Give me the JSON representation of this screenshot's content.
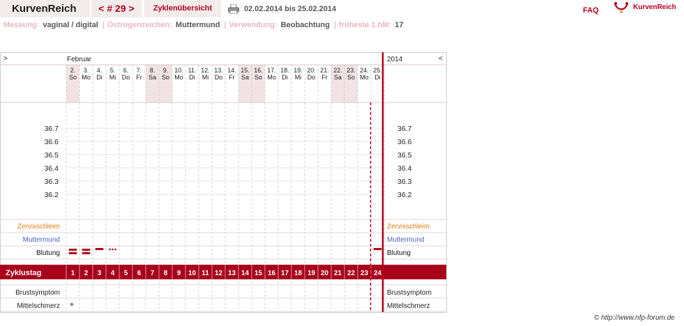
{
  "header": {
    "brand": "KurvenReich",
    "cycle_nav": "< # 29 >",
    "overview_tab": "Zyklenübersicht",
    "date_range": "02.02.2014 bis 25.02.2014",
    "faq": "FAQ",
    "logo_text": "KurvenReich",
    "print_icon": "printer-icon"
  },
  "info": {
    "measurement_label": "Messung:",
    "measurement_value": "vaginal / digital",
    "estrogen_label": "Östrogenzeichen:",
    "estrogen_value": "Muttermund",
    "usage_label": "Verwendung:",
    "usage_value": "Beobachtung",
    "earliest_label": "früheste 1.hM:",
    "earliest_value": "17"
  },
  "chart": {
    "expand_left": ">",
    "expand_right": "<",
    "month": "Februar",
    "year": "2014",
    "days": [
      {
        "date": "2.",
        "wd": "So",
        "cd": "1",
        "weekend": true
      },
      {
        "date": "3.",
        "wd": "Mo",
        "cd": "2",
        "weekend": false
      },
      {
        "date": "4.",
        "wd": "Di",
        "cd": "3",
        "weekend": false
      },
      {
        "date": "5.",
        "wd": "Mi",
        "cd": "4",
        "weekend": false
      },
      {
        "date": "6.",
        "wd": "Do",
        "cd": "5",
        "weekend": false
      },
      {
        "date": "7.",
        "wd": "Fr",
        "cd": "6",
        "weekend": false
      },
      {
        "date": "8.",
        "wd": "Sa",
        "cd": "7",
        "weekend": true
      },
      {
        "date": "9.",
        "wd": "So",
        "cd": "8",
        "weekend": true
      },
      {
        "date": "10.",
        "wd": "Mo",
        "cd": "9",
        "weekend": false
      },
      {
        "date": "11.",
        "wd": "Di",
        "cd": "10",
        "weekend": false
      },
      {
        "date": "12.",
        "wd": "Mi",
        "cd": "11",
        "weekend": false
      },
      {
        "date": "13.",
        "wd": "Do",
        "cd": "12",
        "weekend": false
      },
      {
        "date": "14.",
        "wd": "Fr",
        "cd": "13",
        "weekend": false
      },
      {
        "date": "15.",
        "wd": "Sa",
        "cd": "14",
        "weekend": true
      },
      {
        "date": "16.",
        "wd": "So",
        "cd": "15",
        "weekend": true
      },
      {
        "date": "17.",
        "wd": "Mo",
        "cd": "16",
        "weekend": false
      },
      {
        "date": "18.",
        "wd": "Di",
        "cd": "17",
        "weekend": false
      },
      {
        "date": "19.",
        "wd": "Mi",
        "cd": "18",
        "weekend": false
      },
      {
        "date": "20.",
        "wd": "Do",
        "cd": "19",
        "weekend": false
      },
      {
        "date": "21.",
        "wd": "Fr",
        "cd": "20",
        "weekend": false
      },
      {
        "date": "22.",
        "wd": "Sa",
        "cd": "21",
        "weekend": true
      },
      {
        "date": "23.",
        "wd": "So",
        "cd": "22",
        "weekend": true
      },
      {
        "date": "24.",
        "wd": "Mo",
        "cd": "23",
        "weekend": false
      },
      {
        "date": "25.",
        "wd": "Di",
        "cd": "24",
        "weekend": false
      }
    ],
    "temp_ticks": [
      "36.7",
      "36.6",
      "36.5",
      "36.4",
      "36.3",
      "36.2"
    ],
    "rows": {
      "cervical_mucus": "Zervixschleim",
      "cervix": "Muttermund",
      "bleeding": "Blutung",
      "cycle_day": "Zyklustag",
      "breast": "Brustsymptom",
      "mittelschmerz": "Mittelschmerz"
    },
    "bleeding": [
      {
        "cd": 1,
        "level": "heavy"
      },
      {
        "cd": 2,
        "level": "heavy"
      },
      {
        "cd": 3,
        "level": "medium"
      },
      {
        "cd": 4,
        "level": "spotting"
      },
      {
        "cd": 24,
        "level": "medium"
      }
    ],
    "mittelschmerz_days": [
      1
    ],
    "colors": {
      "accent": "#b3001a",
      "cycle_bar": "#a8001c",
      "weekend": "#f1e2e4",
      "mucus": "#e07a10",
      "cervix": "#4a62c8"
    }
  },
  "footer": "© http://www.nfp-forum.de"
}
